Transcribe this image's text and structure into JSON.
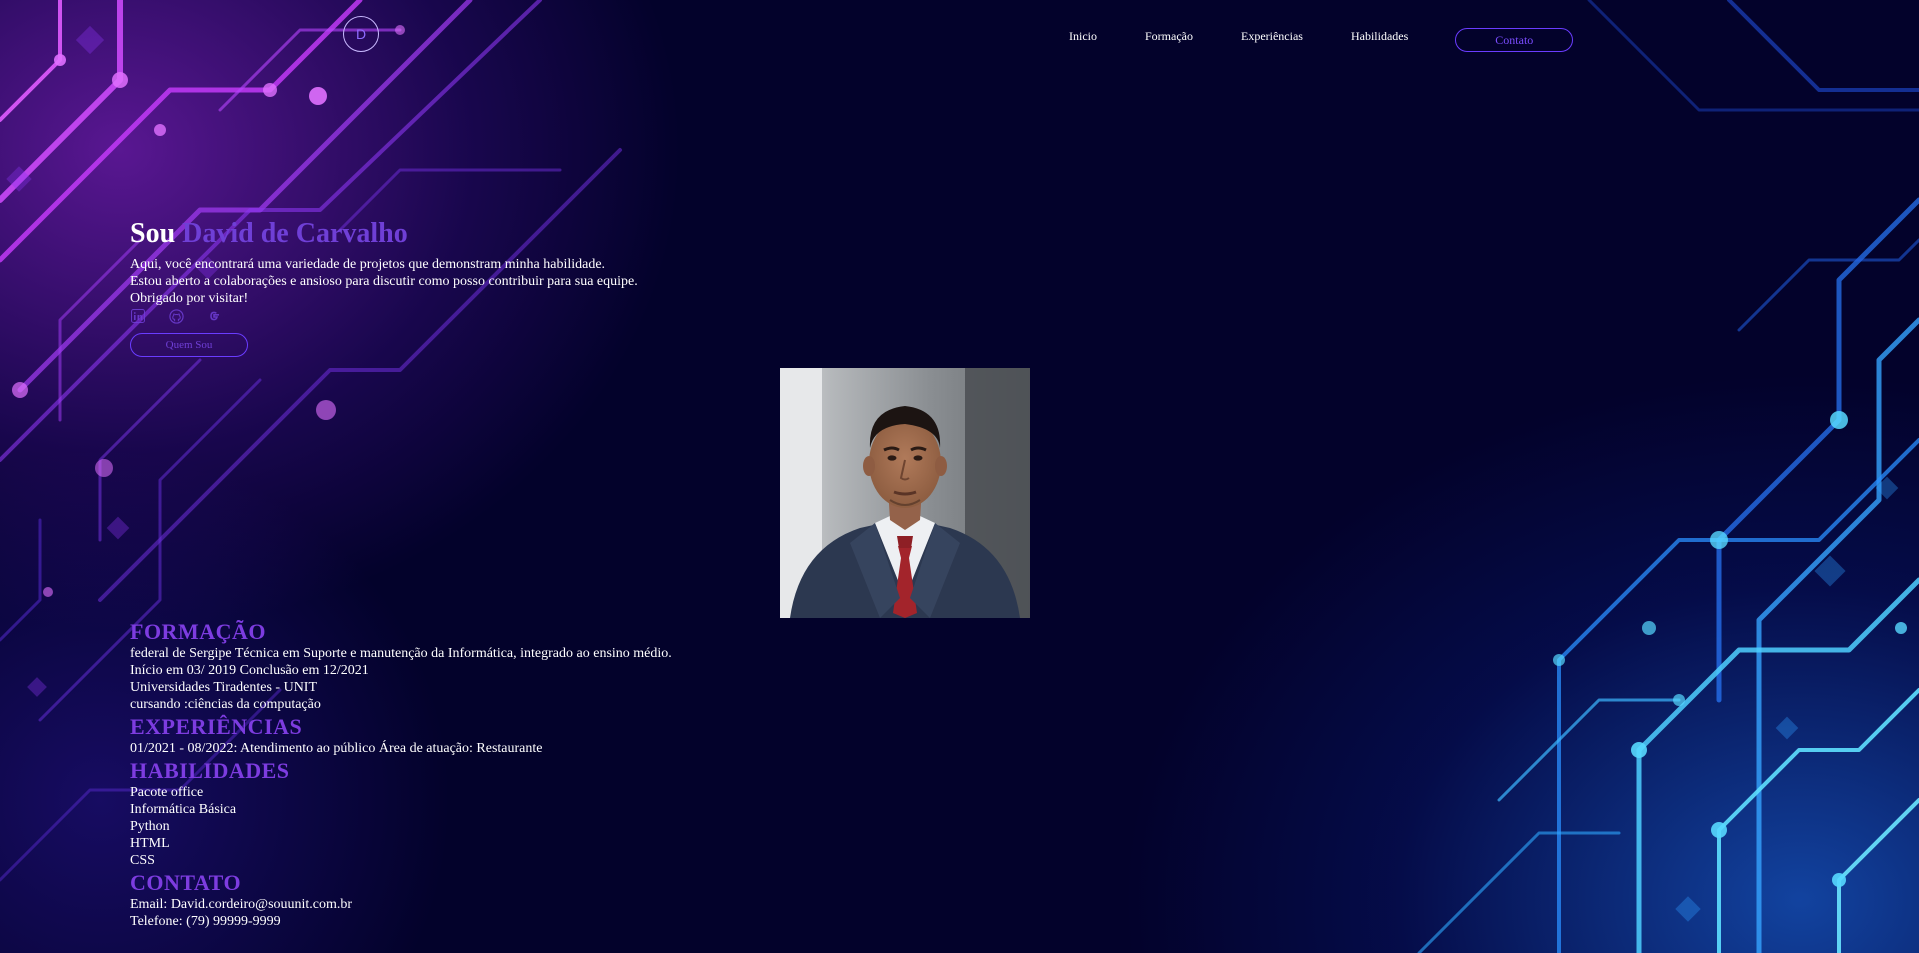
{
  "header": {
    "logo_letter": "D",
    "nav": [
      "Inicio",
      "Formação",
      "Experiências",
      "Habilidades"
    ],
    "contact_button": "Contato"
  },
  "hero": {
    "greeting": "Sou",
    "name": "David de Carvalho",
    "lines": [
      "Aqui, você encontrará uma variedade de projetos que demonstram minha habilidade.",
      "Estou aberto a colaborações e ansioso para discutir como posso contribuir para sua equipe.",
      "Obrigado por visitar!"
    ],
    "socials": [
      "linkedin-icon",
      "github-icon",
      "google-icon"
    ],
    "about_button": "Quem Sou"
  },
  "formacao": {
    "title": "FORMAÇÃO",
    "lines": [
      "federal de Sergipe Técnica em Suporte e manutenção da Informática, integrado ao ensino médio.",
      "Início em 03/ 2019 Conclusão em 12/2021",
      "Universidades Tiradentes - UNIT",
      "cursando :ciências da computação"
    ]
  },
  "experiencias": {
    "title": "EXPERIÊNCIAS",
    "lines": [
      "01/2021 - 08/2022: Atendimento ao público Área de atuação: Restaurante"
    ]
  },
  "habilidades": {
    "title": "HABILIDADES",
    "lines": [
      "Pacote office",
      "Informática Básica",
      "Python",
      "HTML",
      "CSS"
    ]
  },
  "contato": {
    "title": "CONTATO",
    "lines": [
      "Email: David.cordeiro@souunit.com.br",
      "Telefone: (79) 99999-9999"
    ]
  },
  "colors": {
    "background": "#03022b",
    "accent_purple": "#6f3fd6",
    "heading_purple": "#7d3ce0",
    "button_border": "#6a3cff"
  }
}
